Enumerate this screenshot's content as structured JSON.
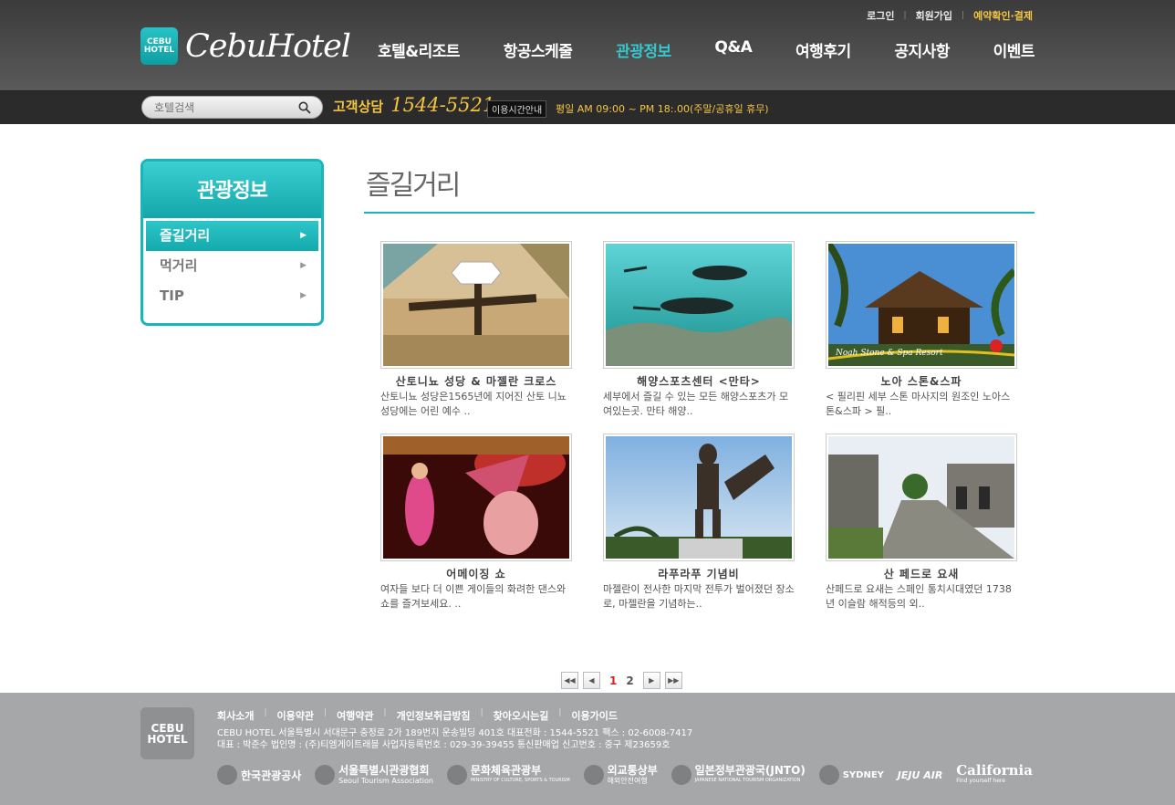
{
  "header": {
    "util_links": [
      "로그인",
      "회원가입",
      "예약확인·결제"
    ],
    "logo_mark": [
      "CEBU",
      "HOTEL"
    ],
    "logo_text": "CebuHotel",
    "nav": [
      "호텔&리조트",
      "항공스케줄",
      "관광정보",
      "Q&A",
      "여행후기",
      "공지사항",
      "이벤트"
    ],
    "active_nav": "관광정보"
  },
  "search": {
    "placeholder": "호텔검색"
  },
  "contact": {
    "label": "고객상담",
    "phone": "1544-5521",
    "hours_badge": "이용시간안내",
    "hours": "평일 AM 09:00 ~ PM 18:.00(주말/공휴일 휴무)"
  },
  "side": {
    "title": "관광정보",
    "items": [
      {
        "label": "즐길거리",
        "active": true
      },
      {
        "label": "먹거리",
        "active": false
      },
      {
        "label": "TIP",
        "active": false
      }
    ]
  },
  "page": {
    "title": "즐길거리"
  },
  "cards": [
    {
      "name": "산토니뇨 성당 & 마젤란 크로스",
      "desc": "산토니뇨 성당은1565년에 지어진 산토 니뇨 성당에는 어린 예수 .."
    },
    {
      "name": "해양스포츠센터 <만타>",
      "desc": "세부에서 즐길 수 있는 모든 해양스포츠가 모여있는곳. 만타 해양.."
    },
    {
      "name": "노아 스톤&스파",
      "desc": "< 필리핀 세부 스톤 마사지의 원조인 노아스톤&스파 > 필.."
    },
    {
      "name": "어메이징 쇼",
      "desc": "여자들 보다 더 이쁜 게이들의 화려한 댄스와 쇼를 즐겨보세요. .."
    },
    {
      "name": "라푸라푸 기념비",
      "desc": "마젤란이 전사한 마지막 전투가 벌어졌던 장소로, 마젤란을 기념하는.."
    },
    {
      "name": "산 페드로 요새",
      "desc": "산페드로 요새는 스페인 통치시대였던 1738년 이슬람 해적등의 외.."
    }
  ],
  "card3_overlay": "Noah Stone & Spa Resort",
  "pagination": {
    "pages": [
      "1",
      "2"
    ],
    "current": "1"
  },
  "footer": {
    "logo": [
      "CEBU",
      "HOTEL"
    ],
    "links": [
      "회사소개",
      "이용약관",
      "여행약관",
      "개인정보취급방침",
      "찾아오시는길",
      "이용가이드"
    ],
    "info_line1": "CEBU HOTEL  서울특별시 서대문구 충정로 2가 189번지 운송빌딩 401호   대표전화 : 1544-5521   팩스 : 02-6008-7417",
    "info_line2": "대표 :  박준수    법인명 : (주)티엠게이트래블     사업자등록번호 : 029-39-39455    통신판매업 신고번호 : 중구 제23659호",
    "partners": [
      {
        "name": "한국관광공사",
        "sub": ""
      },
      {
        "name": "서울특별시관광협회",
        "sub": "Seoul Tourism Association"
      },
      {
        "name": "문화체육관광부",
        "sub": "MINISTRY OF CULTURE, SPORTS & TOURISM"
      },
      {
        "name": "외교통상부",
        "sub": "해외안전여행"
      },
      {
        "name": "일본정부관광국(JNTO)",
        "sub": "JAPANESE NATIONAL TOURISM ORGANIZATION"
      },
      {
        "name": "SYDNEY",
        "sub": ""
      },
      {
        "name": "JEJU AIR",
        "sub": ""
      },
      {
        "name": "California",
        "sub": "Find yourself here"
      }
    ]
  },
  "colors": {
    "accent": "#1bb5b8",
    "header_bg": "#4a4a4a",
    "footer_bg": "#a5a7a9",
    "highlight": "#f3c443"
  }
}
